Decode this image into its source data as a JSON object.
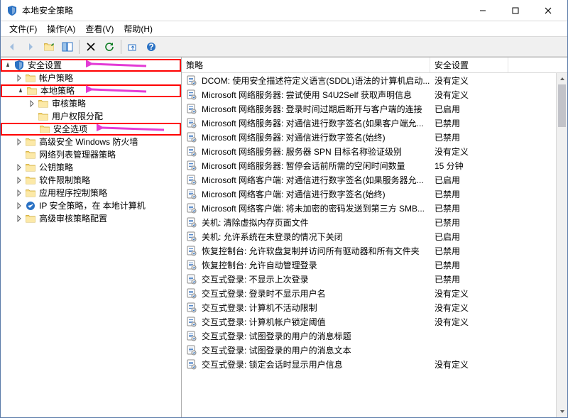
{
  "window": {
    "title": "本地安全策略"
  },
  "menubar": [
    {
      "label": "文件(F)"
    },
    {
      "label": "操作(A)"
    },
    {
      "label": "查看(V)"
    },
    {
      "label": "帮助(H)"
    }
  ],
  "tree": [
    {
      "id": "root",
      "label": "安全设置",
      "indent": 0,
      "expand": "open",
      "highlight": true,
      "arrow": true,
      "icon": "security"
    },
    {
      "id": "account",
      "label": "帐户策略",
      "indent": 1,
      "expand": "closed",
      "icon": "folder"
    },
    {
      "id": "local",
      "label": "本地策略",
      "indent": 1,
      "expand": "open",
      "highlight": true,
      "arrow": true,
      "icon": "folder"
    },
    {
      "id": "audit",
      "label": "审核策略",
      "indent": 2,
      "expand": "closed",
      "icon": "folder"
    },
    {
      "id": "rights",
      "label": "用户权限分配",
      "indent": 2,
      "expand": "none",
      "icon": "folder"
    },
    {
      "id": "secopt",
      "label": "安全选项",
      "indent": 2,
      "expand": "none",
      "highlight": true,
      "arrow": true,
      "icon": "folder"
    },
    {
      "id": "firewall",
      "label": "高级安全 Windows 防火墙",
      "indent": 1,
      "expand": "closed",
      "icon": "folder"
    },
    {
      "id": "netlist",
      "label": "网络列表管理器策略",
      "indent": 1,
      "expand": "none",
      "icon": "folder"
    },
    {
      "id": "pubkey",
      "label": "公钥策略",
      "indent": 1,
      "expand": "closed",
      "icon": "folder"
    },
    {
      "id": "swrestrict",
      "label": "软件限制策略",
      "indent": 1,
      "expand": "closed",
      "icon": "folder"
    },
    {
      "id": "appctrl",
      "label": "应用程序控制策略",
      "indent": 1,
      "expand": "closed",
      "icon": "folder"
    },
    {
      "id": "ipsec",
      "label": "IP 安全策略，在 本地计算机",
      "indent": 1,
      "expand": "closed",
      "icon": "ipsec"
    },
    {
      "id": "advaudit",
      "label": "高级审核策略配置",
      "indent": 1,
      "expand": "closed",
      "icon": "folder"
    }
  ],
  "list": {
    "col1": "策略",
    "col2": "安全设置",
    "rows": [
      {
        "name": "DCOM: 使用安全描述符定义语言(SDDL)语法的计算机启动...",
        "value": "没有定义"
      },
      {
        "name": "Microsoft 网络服务器: 尝试使用 S4U2Self 获取声明信息",
        "value": "没有定义"
      },
      {
        "name": "Microsoft 网络服务器: 登录时间过期后断开与客户端的连接",
        "value": "已启用"
      },
      {
        "name": "Microsoft 网络服务器: 对通信进行数字签名(如果客户端允...",
        "value": "已禁用"
      },
      {
        "name": "Microsoft 网络服务器: 对通信进行数字签名(始终)",
        "value": "已禁用"
      },
      {
        "name": "Microsoft 网络服务器: 服务器 SPN 目标名称验证级别",
        "value": "没有定义"
      },
      {
        "name": "Microsoft 网络服务器: 暂停会话前所需的空闲时间数量",
        "value": "15 分钟"
      },
      {
        "name": "Microsoft 网络客户端: 对通信进行数字签名(如果服务器允...",
        "value": "已启用"
      },
      {
        "name": "Microsoft 网络客户端: 对通信进行数字签名(始终)",
        "value": "已禁用"
      },
      {
        "name": "Microsoft 网络客户端: 将未加密的密码发送到第三方 SMB...",
        "value": "已禁用"
      },
      {
        "name": "关机: 清除虚拟内存页面文件",
        "value": "已禁用"
      },
      {
        "name": "关机: 允许系统在未登录的情况下关闭",
        "value": "已启用"
      },
      {
        "name": "恢复控制台: 允许软盘复制并访问所有驱动器和所有文件夹",
        "value": "已禁用"
      },
      {
        "name": "恢复控制台: 允许自动管理登录",
        "value": "已禁用"
      },
      {
        "name": "交互式登录: 不显示上次登录",
        "value": "已禁用"
      },
      {
        "name": "交互式登录: 登录时不显示用户名",
        "value": "没有定义"
      },
      {
        "name": "交互式登录: 计算机不活动限制",
        "value": "没有定义"
      },
      {
        "name": "交互式登录: 计算机帐户锁定阈值",
        "value": "没有定义"
      },
      {
        "name": "交互式登录: 试图登录的用户的消息标题",
        "value": ""
      },
      {
        "name": "交互式登录: 试图登录的用户的消息文本",
        "value": ""
      },
      {
        "name": "交互式登录: 锁定会话时显示用户信息",
        "value": "没有定义"
      }
    ]
  }
}
